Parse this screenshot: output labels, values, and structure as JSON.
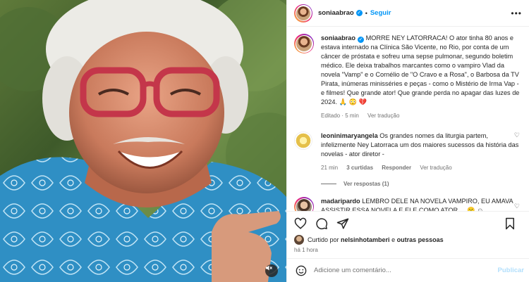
{
  "post": {
    "username": "soniaabrao",
    "follow_label": "Seguir",
    "dot": "•",
    "more": "•••"
  },
  "caption": {
    "username": "soniaabrao",
    "text": "MORRE NEY LATORRACA! O ator tinha 80 anos e estava internado na Clínica São Vicente, no Rio, por conta de um câncer de próstata e sofreu uma sepse pulmonar, segundo boletim médico. Ele deixa trabalhos marcantes como o vampiro Vlad da novela \"Vamp\" e o Cornélio de \"O Cravo e a Rosa\", o Barbosa da TV Pirata, inúmeras minisséries e peças - como o Mistério de Irma Vap - e filmes! Que grande ator! Que grande perda no apagar das luzes de 2024. 🙏 😳 💔",
    "edited": "Editado · 5 min",
    "translate": "Ver tradução"
  },
  "comments": [
    {
      "username": "leoninimaryangela",
      "text": "Os grandes nomes da liturgia partem, infelizmente Ney Latorraca um dos maiores sucessos da história das novelas - ator diretor -",
      "time": "21 min",
      "likes": "3 curtidas",
      "reply": "Responder",
      "translate": "Ver tradução",
      "view_replies": "Ver respostas (1)"
    },
    {
      "username": "madaripardo",
      "text": "LEMBRO DELE NA NOVELA VAMPIRO, EU AMAVA ASSISTIR ESSA NOVELA E ELE COMO ATOR ... 😮 ☺"
    }
  ],
  "likes": {
    "prefix": "Curtido por",
    "user": "nelsinhotamberi",
    "conj": "e",
    "others": "outras pessoas"
  },
  "time_ago": "há 1 hora",
  "add_comment": {
    "placeholder": "Adicione um comentário...",
    "publish": "Publicar"
  },
  "icons": {
    "like": "heart-icon",
    "comment": "comment-icon",
    "share": "share-icon",
    "save": "bookmark-icon",
    "emoji": "emoji-icon",
    "mute": "speaker-muted-icon"
  },
  "colors": {
    "link": "#0095f6",
    "muted_text": "#737373",
    "publish_disabled": "#b2dffc"
  }
}
